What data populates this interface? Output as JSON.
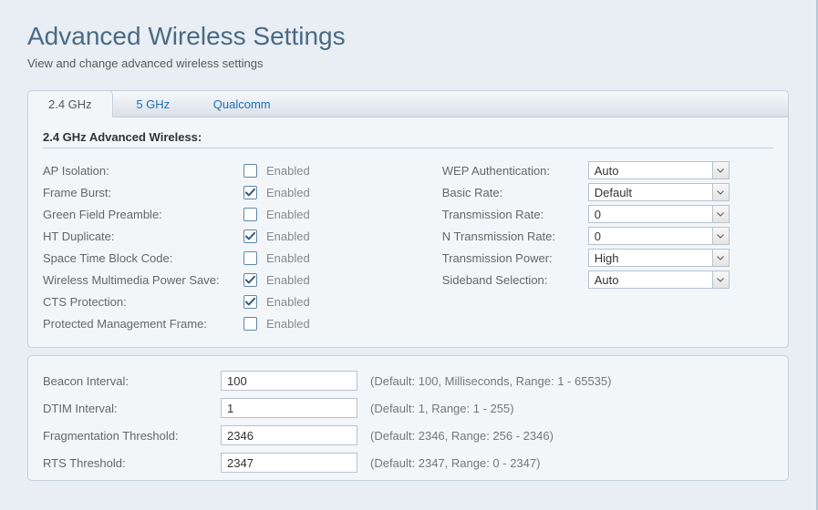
{
  "header": {
    "title": "Advanced Wireless Settings",
    "subtitle": "View and change advanced wireless settings"
  },
  "tabs": [
    {
      "label": "2.4 GHz",
      "active": true
    },
    {
      "label": "5 GHz",
      "active": false
    },
    {
      "label": "Qualcomm",
      "active": false
    }
  ],
  "section_title": "2.4 GHz Advanced Wireless:",
  "enabled_label": "Enabled",
  "left_settings": [
    {
      "key": "ap_isolation",
      "label": "AP Isolation:",
      "checked": false
    },
    {
      "key": "frame_burst",
      "label": "Frame Burst:",
      "checked": true
    },
    {
      "key": "green_field_preamble",
      "label": "Green Field Preamble:",
      "checked": false
    },
    {
      "key": "ht_duplicate",
      "label": "HT Duplicate:",
      "checked": true
    },
    {
      "key": "space_time_block_code",
      "label": "Space Time Block Code:",
      "checked": false
    },
    {
      "key": "wireless_multimedia_power_save",
      "label": "Wireless Multimedia Power Save:",
      "checked": true
    },
    {
      "key": "cts_protection",
      "label": "CTS Protection:",
      "checked": true
    },
    {
      "key": "protected_management_frame",
      "label": "Protected Management Frame:",
      "checked": false
    }
  ],
  "right_settings": [
    {
      "key": "wep_authentication",
      "label": "WEP Authentication:",
      "value": "Auto"
    },
    {
      "key": "basic_rate",
      "label": "Basic Rate:",
      "value": "Default"
    },
    {
      "key": "transmission_rate",
      "label": "Transmission Rate:",
      "value": "0"
    },
    {
      "key": "n_transmission_rate",
      "label": "N Transmission Rate:",
      "value": "0"
    },
    {
      "key": "transmission_power",
      "label": "Transmission Power:",
      "value": "High"
    },
    {
      "key": "sideband_selection",
      "label": "Sideband Selection:",
      "value": "Auto"
    }
  ],
  "bottom_settings": [
    {
      "key": "beacon_interval",
      "label": "Beacon Interval:",
      "value": "100",
      "hint": "(Default: 100, Milliseconds, Range: 1 - 65535)"
    },
    {
      "key": "dtim_interval",
      "label": "DTIM Interval:",
      "value": "1",
      "hint": "(Default: 1, Range: 1 - 255)"
    },
    {
      "key": "fragmentation_threshold",
      "label": "Fragmentation Threshold:",
      "value": "2346",
      "hint": "(Default: 2346, Range: 256 - 2346)"
    },
    {
      "key": "rts_threshold",
      "label": "RTS Threshold:",
      "value": "2347",
      "hint": "(Default: 2347, Range: 0 - 2347)"
    }
  ]
}
